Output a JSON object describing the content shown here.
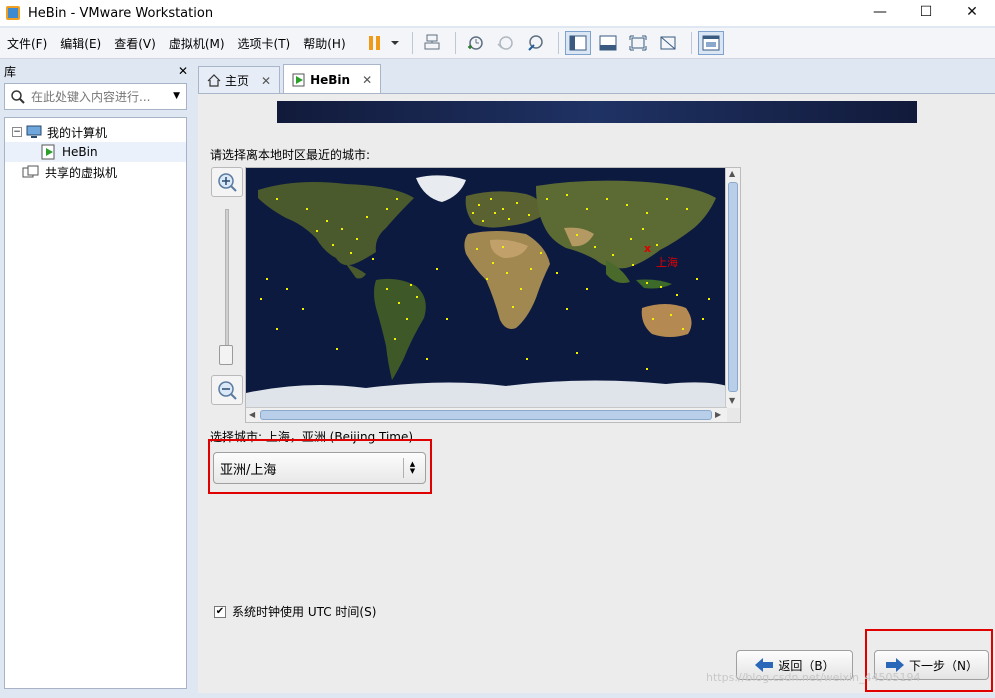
{
  "window": {
    "title": "HeBin - VMware Workstation",
    "min": "—",
    "max": "☐",
    "close": "✕"
  },
  "menu": [
    "文件(F)",
    "编辑(E)",
    "查看(V)",
    "虚拟机(M)",
    "选项卡(T)",
    "帮助(H)"
  ],
  "library": {
    "title": "库",
    "close": "✕",
    "search_placeholder": "在此处键入内容进行...",
    "tree": {
      "my_computer": "我的计算机",
      "vm": "HeBin",
      "shared": "共享的虚拟机"
    }
  },
  "tabs": [
    {
      "label": "主页",
      "close": "✕"
    },
    {
      "label": "HeBin",
      "close": "✕"
    }
  ],
  "installer": {
    "prompt": "请选择离本地时区最近的城市:",
    "map_city_label": "上海",
    "map_marker": "x",
    "selected_city_text": "选择城市: 上海，亚洲 (Beijing Time)",
    "timezone_value": "亚洲/上海",
    "utc_label": "系统时钟使用 UTC 时间(S)",
    "utc_checked": "✔",
    "back_button": "返回（B）",
    "next_button": "下一步（N）"
  },
  "watermark": "https://blog.csdn.net/weixin_44505194",
  "colors": {
    "highlight": "#e00000",
    "ocean": "#0d1a40",
    "city_dot": "#f0f000"
  }
}
